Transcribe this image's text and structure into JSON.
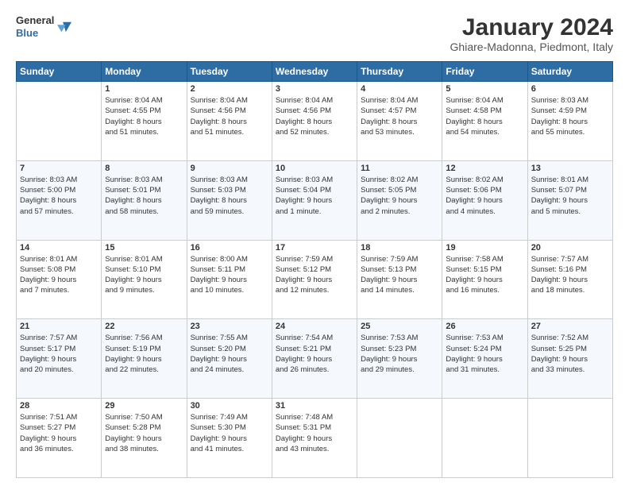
{
  "header": {
    "logo_line1": "General",
    "logo_line2": "Blue",
    "month": "January 2024",
    "location": "Ghiare-Madonna, Piedmont, Italy"
  },
  "days_of_week": [
    "Sunday",
    "Monday",
    "Tuesday",
    "Wednesday",
    "Thursday",
    "Friday",
    "Saturday"
  ],
  "weeks": [
    [
      {
        "day": "",
        "info": ""
      },
      {
        "day": "1",
        "info": "Sunrise: 8:04 AM\nSunset: 4:55 PM\nDaylight: 8 hours\nand 51 minutes."
      },
      {
        "day": "2",
        "info": "Sunrise: 8:04 AM\nSunset: 4:56 PM\nDaylight: 8 hours\nand 51 minutes."
      },
      {
        "day": "3",
        "info": "Sunrise: 8:04 AM\nSunset: 4:56 PM\nDaylight: 8 hours\nand 52 minutes."
      },
      {
        "day": "4",
        "info": "Sunrise: 8:04 AM\nSunset: 4:57 PM\nDaylight: 8 hours\nand 53 minutes."
      },
      {
        "day": "5",
        "info": "Sunrise: 8:04 AM\nSunset: 4:58 PM\nDaylight: 8 hours\nand 54 minutes."
      },
      {
        "day": "6",
        "info": "Sunrise: 8:03 AM\nSunset: 4:59 PM\nDaylight: 8 hours\nand 55 minutes."
      }
    ],
    [
      {
        "day": "7",
        "info": "Sunrise: 8:03 AM\nSunset: 5:00 PM\nDaylight: 8 hours\nand 57 minutes."
      },
      {
        "day": "8",
        "info": "Sunrise: 8:03 AM\nSunset: 5:01 PM\nDaylight: 8 hours\nand 58 minutes."
      },
      {
        "day": "9",
        "info": "Sunrise: 8:03 AM\nSunset: 5:03 PM\nDaylight: 8 hours\nand 59 minutes."
      },
      {
        "day": "10",
        "info": "Sunrise: 8:03 AM\nSunset: 5:04 PM\nDaylight: 9 hours\nand 1 minute."
      },
      {
        "day": "11",
        "info": "Sunrise: 8:02 AM\nSunset: 5:05 PM\nDaylight: 9 hours\nand 2 minutes."
      },
      {
        "day": "12",
        "info": "Sunrise: 8:02 AM\nSunset: 5:06 PM\nDaylight: 9 hours\nand 4 minutes."
      },
      {
        "day": "13",
        "info": "Sunrise: 8:01 AM\nSunset: 5:07 PM\nDaylight: 9 hours\nand 5 minutes."
      }
    ],
    [
      {
        "day": "14",
        "info": "Sunrise: 8:01 AM\nSunset: 5:08 PM\nDaylight: 9 hours\nand 7 minutes."
      },
      {
        "day": "15",
        "info": "Sunrise: 8:01 AM\nSunset: 5:10 PM\nDaylight: 9 hours\nand 9 minutes."
      },
      {
        "day": "16",
        "info": "Sunrise: 8:00 AM\nSunset: 5:11 PM\nDaylight: 9 hours\nand 10 minutes."
      },
      {
        "day": "17",
        "info": "Sunrise: 7:59 AM\nSunset: 5:12 PM\nDaylight: 9 hours\nand 12 minutes."
      },
      {
        "day": "18",
        "info": "Sunrise: 7:59 AM\nSunset: 5:13 PM\nDaylight: 9 hours\nand 14 minutes."
      },
      {
        "day": "19",
        "info": "Sunrise: 7:58 AM\nSunset: 5:15 PM\nDaylight: 9 hours\nand 16 minutes."
      },
      {
        "day": "20",
        "info": "Sunrise: 7:57 AM\nSunset: 5:16 PM\nDaylight: 9 hours\nand 18 minutes."
      }
    ],
    [
      {
        "day": "21",
        "info": "Sunrise: 7:57 AM\nSunset: 5:17 PM\nDaylight: 9 hours\nand 20 minutes."
      },
      {
        "day": "22",
        "info": "Sunrise: 7:56 AM\nSunset: 5:19 PM\nDaylight: 9 hours\nand 22 minutes."
      },
      {
        "day": "23",
        "info": "Sunrise: 7:55 AM\nSunset: 5:20 PM\nDaylight: 9 hours\nand 24 minutes."
      },
      {
        "day": "24",
        "info": "Sunrise: 7:54 AM\nSunset: 5:21 PM\nDaylight: 9 hours\nand 26 minutes."
      },
      {
        "day": "25",
        "info": "Sunrise: 7:53 AM\nSunset: 5:23 PM\nDaylight: 9 hours\nand 29 minutes."
      },
      {
        "day": "26",
        "info": "Sunrise: 7:53 AM\nSunset: 5:24 PM\nDaylight: 9 hours\nand 31 minutes."
      },
      {
        "day": "27",
        "info": "Sunrise: 7:52 AM\nSunset: 5:25 PM\nDaylight: 9 hours\nand 33 minutes."
      }
    ],
    [
      {
        "day": "28",
        "info": "Sunrise: 7:51 AM\nSunset: 5:27 PM\nDaylight: 9 hours\nand 36 minutes."
      },
      {
        "day": "29",
        "info": "Sunrise: 7:50 AM\nSunset: 5:28 PM\nDaylight: 9 hours\nand 38 minutes."
      },
      {
        "day": "30",
        "info": "Sunrise: 7:49 AM\nSunset: 5:30 PM\nDaylight: 9 hours\nand 41 minutes."
      },
      {
        "day": "31",
        "info": "Sunrise: 7:48 AM\nSunset: 5:31 PM\nDaylight: 9 hours\nand 43 minutes."
      },
      {
        "day": "",
        "info": ""
      },
      {
        "day": "",
        "info": ""
      },
      {
        "day": "",
        "info": ""
      }
    ]
  ]
}
